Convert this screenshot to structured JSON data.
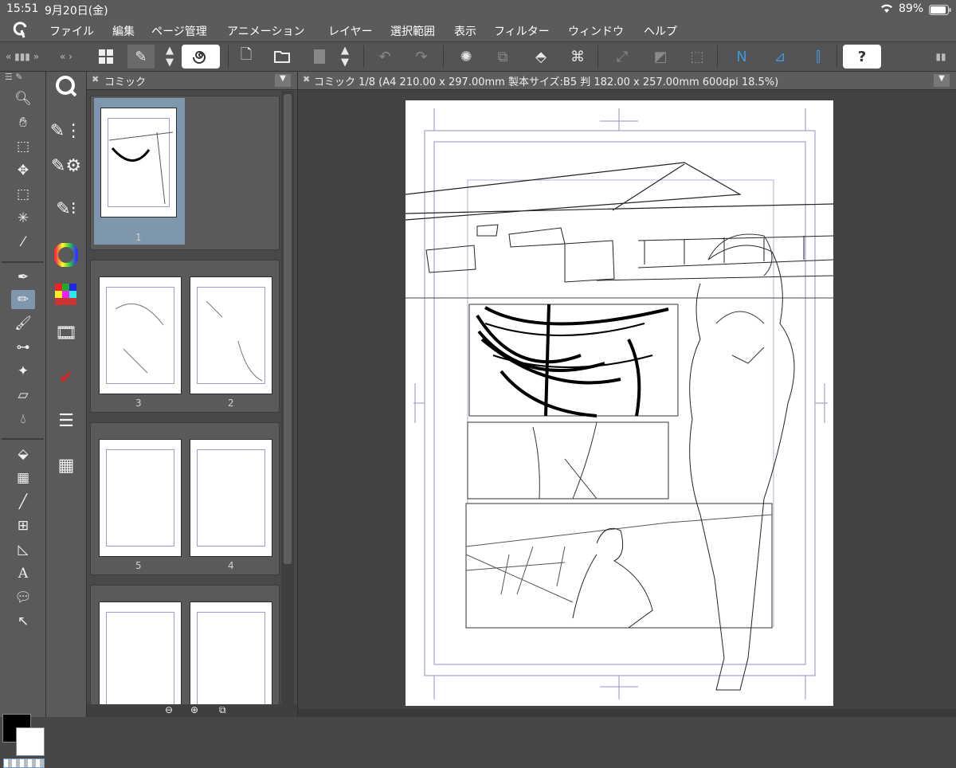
{
  "status": {
    "time": "15:51",
    "date": "9月20日(金)",
    "battery": "89%"
  },
  "menu": [
    "ファイル",
    "編集",
    "ページ管理",
    "アニメーション",
    "レイヤー",
    "選択範囲",
    "表示",
    "フィルター",
    "ウィンドウ",
    "ヘルプ"
  ],
  "page_panel": {
    "title": "コミック",
    "pages": [
      "1",
      "3",
      "2",
      "5",
      "4"
    ]
  },
  "canvas_tab": {
    "title": "コミック 1/8 (A4 210.00 x 297.00mm 製本サイズ:B5 判 182.00 x 257.00mm 600dpi 18.5%)"
  },
  "colors": {
    "accent": "#3a9ad9",
    "selected_tool": "#7f97ad",
    "foreground": "#000000",
    "background": "#ffffff"
  }
}
